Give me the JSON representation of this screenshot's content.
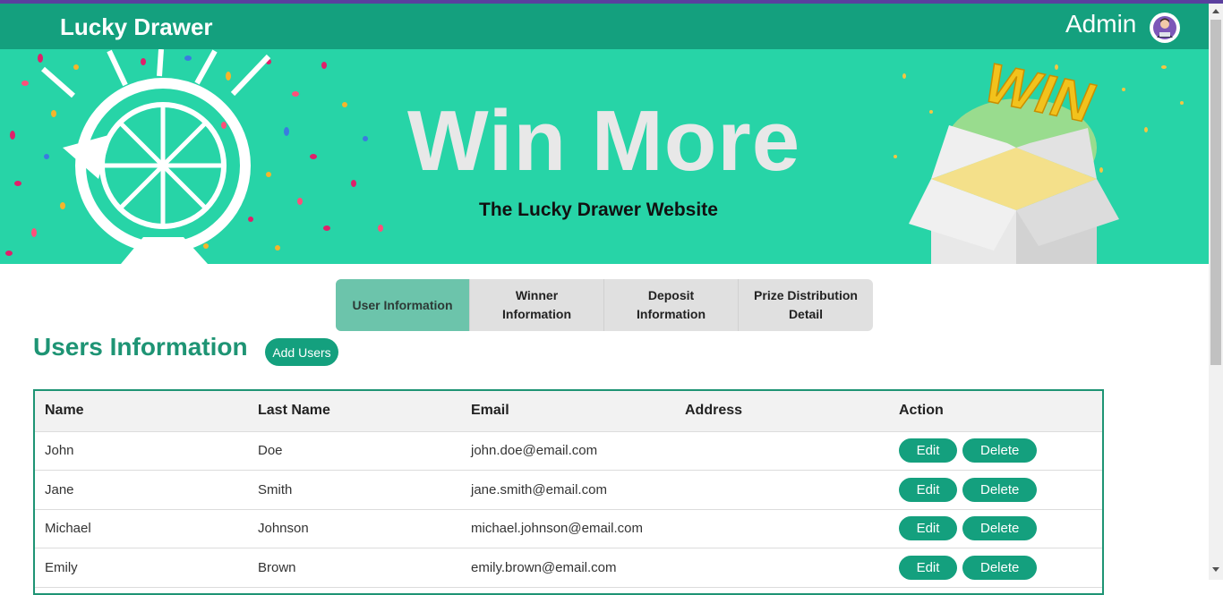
{
  "navbar": {
    "brand": "Lucky Drawer",
    "user_label": "Admin",
    "avatar_icon": "user-avatar-icon"
  },
  "banner": {
    "title": "Win More",
    "subtitle": "The Lucky Drawer Website",
    "badge_text": "WIN"
  },
  "tabs": [
    {
      "label": "User Information",
      "active": true
    },
    {
      "label": "Winner Information",
      "active": false
    },
    {
      "label": "Deposit Information",
      "active": false
    },
    {
      "label": "Prize Distribution Detail",
      "active": false
    }
  ],
  "section": {
    "title": "Users Information",
    "add_button": "Add Users"
  },
  "table": {
    "headers": [
      "Name",
      "Last Name",
      "Email",
      "Address",
      "Action"
    ],
    "rows": [
      {
        "name": "John",
        "last_name": "Doe",
        "email": "john.doe@email.com",
        "address": ""
      },
      {
        "name": "Jane",
        "last_name": "Smith",
        "email": "jane.smith@email.com",
        "address": ""
      },
      {
        "name": "Michael",
        "last_name": "Johnson",
        "email": "michael.johnson@email.com",
        "address": ""
      },
      {
        "name": "Emily",
        "last_name": "Brown",
        "email": "emily.brown@email.com",
        "address": ""
      }
    ],
    "edit_label": "Edit",
    "delete_label": "Delete"
  },
  "colors": {
    "primary": "#14a07e",
    "banner": "#27d4a7",
    "active_tab": "#6cc4ab",
    "top_line": "#5a3f9e"
  }
}
